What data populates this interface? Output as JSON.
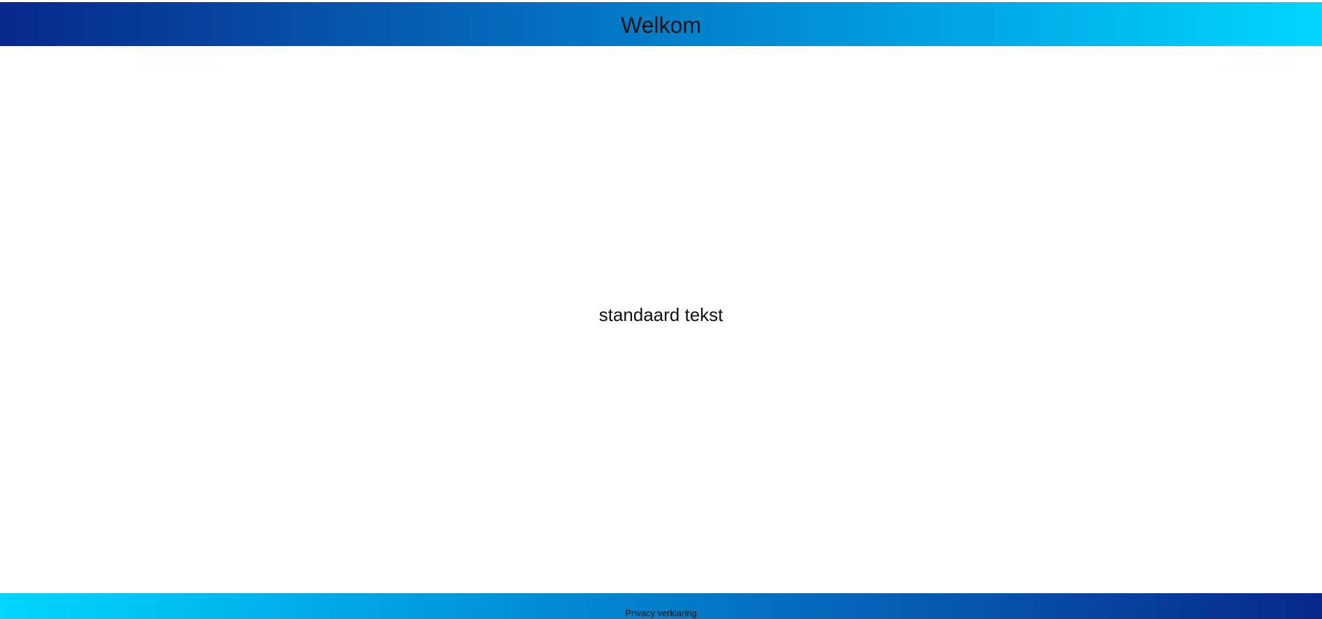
{
  "header": {
    "title": "Welkom"
  },
  "main": {
    "text": "standaard tekst"
  },
  "footer": {
    "link_label": "Privacy verklaring"
  },
  "colors": {
    "gradient_dark": "#07288c",
    "gradient_light": "#00d6ff",
    "background": "#fefefe",
    "text": "#111111"
  }
}
